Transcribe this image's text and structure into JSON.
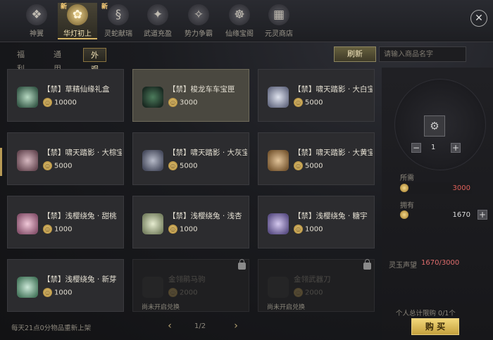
{
  "nav": {
    "tabs": [
      {
        "label": "神翼",
        "icon": "wing-icon",
        "badge": ""
      },
      {
        "label": "华灯初上",
        "icon": "lotus-icon",
        "badge": "新"
      },
      {
        "label": "灵蛇献瑞",
        "icon": "snake-icon",
        "badge": "新"
      },
      {
        "label": "武道充盈",
        "icon": "emblem-icon",
        "badge": ""
      },
      {
        "label": "势力争霸",
        "icon": "banner-icon",
        "badge": ""
      },
      {
        "label": "仙缘宝阁",
        "icon": "pavilion-icon",
        "badge": ""
      },
      {
        "label": "元灵商店",
        "icon": "shop-icon",
        "badge": ""
      }
    ],
    "active_index": 1
  },
  "subtabs": [
    "福利",
    "通用",
    "外观"
  ],
  "toolbar": {
    "refresh_label": "刷新",
    "search_placeholder": "请输入商品名字"
  },
  "items": [
    {
      "name": "【禁】草精仙缘礼盒",
      "price": "10000"
    },
    {
      "name": "【禁】梭龙车车宝匣",
      "price": "3000"
    },
    {
      "name": "【禁】啸天踏影 · 大白宝",
      "price": "5000"
    },
    {
      "name": "【禁】啸天踏影 · 大棕宝",
      "price": "5000"
    },
    {
      "name": "【禁】啸天踏影 · 大灰宝",
      "price": "5000"
    },
    {
      "name": "【禁】啸天踏影 · 大黄宝",
      "price": "5000"
    },
    {
      "name": "【禁】浅樱绕兔 · 甜桃",
      "price": "1000"
    },
    {
      "name": "【禁】浅樱绕兔 · 浅杏",
      "price": "1000"
    },
    {
      "name": "【禁】浅樱绕兔 · 糖宇",
      "price": "1000"
    },
    {
      "name": "【禁】浅樱绕兔 · 新芽",
      "price": "1000"
    },
    {
      "name": "金翎鹃马驹",
      "price": "2000",
      "note": "尚未开启兑换"
    },
    {
      "name": "金翎武器刀",
      "price": "2000",
      "note": "尚未开启兑换"
    }
  ],
  "footer": {
    "note": "每天21点0分物品重新上架",
    "page": "1/2"
  },
  "detail": {
    "qty": "1",
    "need_label": "所需",
    "need_value": "3000",
    "have_label": "拥有",
    "have_value": "1670",
    "reputation_label": "灵玉声望",
    "reputation_value": "1670/3000",
    "limit_label": "个人总计限购 0/1个",
    "buy_label": "购 买"
  },
  "colors": {
    "accent_gold": "#d8b564",
    "buy_gold": "#f2d77a",
    "need_red": "#e0605a"
  }
}
